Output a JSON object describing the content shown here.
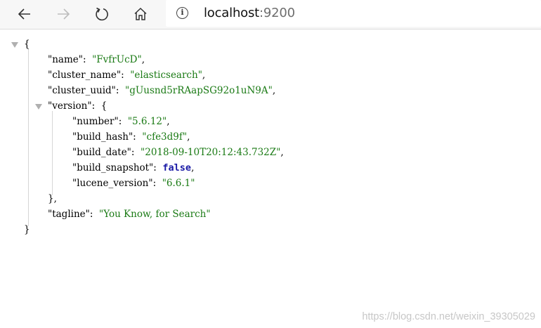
{
  "browser": {
    "url_host": "localhost",
    "url_port": ":9200",
    "icons": {
      "back": "back-arrow-icon",
      "forward": "forward-arrow-icon",
      "refresh": "refresh-icon",
      "home": "home-icon",
      "info": "info-icon"
    }
  },
  "json_view": {
    "open_brace": "{",
    "close_brace": "}",
    "name": {
      "key": "\"name\"",
      "value": "\"FvfrUcD\""
    },
    "cluster_name": {
      "key": "\"cluster_name\"",
      "value": "\"elasticsearch\""
    },
    "cluster_uuid": {
      "key": "\"cluster_uuid\"",
      "value": "\"gUusnd5rRAapSG92o1uN9A\""
    },
    "version": {
      "key": "\"version\"",
      "open": "{",
      "close": "},",
      "number": {
        "key": "\"number\"",
        "value": "\"5.6.12\""
      },
      "build_hash": {
        "key": "\"build_hash\"",
        "value": "\"cfe3d9f\""
      },
      "build_date": {
        "key": "\"build_date\"",
        "value": "\"2018-09-10T20:12:43.732Z\""
      },
      "build_snapshot": {
        "key": "\"build_snapshot\"",
        "value": "false"
      },
      "lucene_version": {
        "key": "\"lucene_version\"",
        "value": "\"6.6.1\""
      }
    },
    "tagline": {
      "key": "\"tagline\"",
      "value": "\"You Know, for Search\""
    }
  },
  "watermark": "https://blog.csdn.net/weixin_39305029",
  "colors": {
    "string": "#1a7a14",
    "boolean": "#1a1aa6",
    "toggle": "#b0b0b0",
    "toolbar_bg": "#f7f7f7"
  }
}
